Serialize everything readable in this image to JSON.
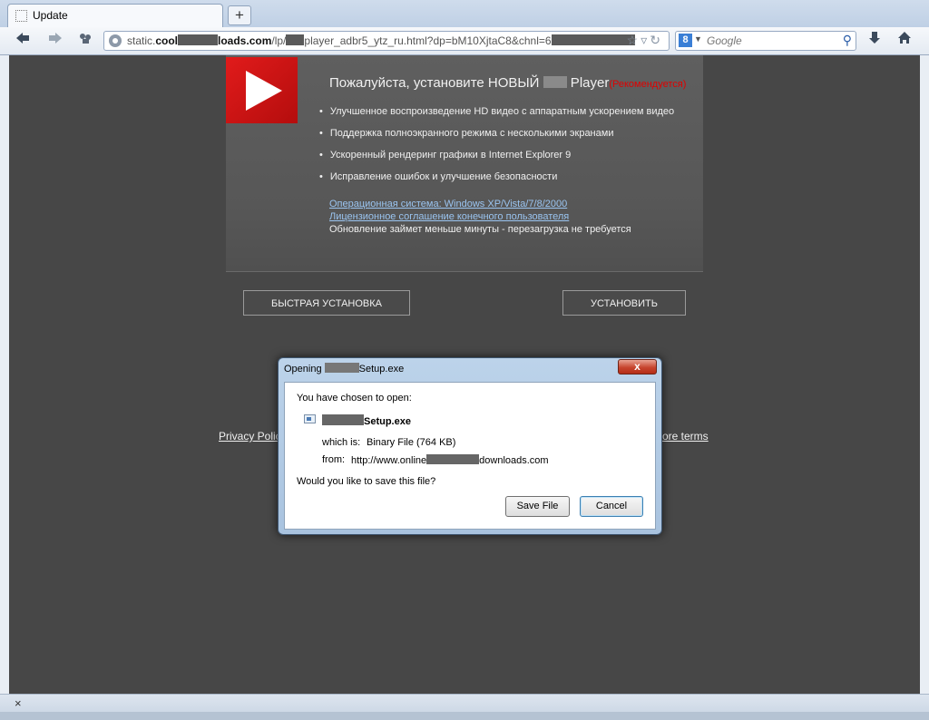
{
  "browser": {
    "tab_title": "Update",
    "new_tab_symbol": "+",
    "url_prefix": "static.",
    "url_host_start": "cool",
    "url_host_end": "loads.com",
    "url_path_start": "/lp/",
    "url_path_mid": "player_adbr5_ytz_ru.html?dp=bM10XjtaC8&chnl=6",
    "search_engine_badge": "8",
    "search_placeholder": "Google",
    "status_close_symbol": "×"
  },
  "page": {
    "headline_start": "Пожалуйста, установите НОВЫЙ",
    "headline_end": " Player",
    "headline_recommended": "(Рекомендуется)",
    "features": [
      "Улучшенное воспроизведение HD видео с аппаратным ускорением видео",
      "Поддержка полноэкранного режима с несколькими экранами",
      "Ускоренный рендеринг графики в Internet Explorer 9",
      "Исправление ошибок и улучшение безопасности"
    ],
    "link_os": "Операционная система: Windows XP/Vista/7/8/2000",
    "link_eula": "Лицензионное соглашение конечного пользователя",
    "update_note": "Обновление займет меньше минуты - перезагрузка не требуется",
    "quick_install_label": "БЫСТРАЯ УСТАНОВКА",
    "install_label": "УСТАНОВИТЬ",
    "footer_privacy": "Privacy Polic",
    "footer_terms": "ore terms"
  },
  "dialog": {
    "title_start": "Opening",
    "title_end": "Setup.exe",
    "close_symbol": "x",
    "intro": "You have chosen to open:",
    "file_name_end": "Setup.exe",
    "which_is_label": "which is:",
    "which_is_value": "Binary File (764 KB)",
    "from_label": "from:",
    "from_value_start": "http://www.online",
    "from_value_end": "downloads.com",
    "question": "Would you like to save this file?",
    "save_label": "Save File",
    "cancel_label": "Cancel"
  },
  "colors": {
    "page_bg": "#474747",
    "banner_bg": "#5a5a5a",
    "play_logo_red": "#d41414",
    "recommended_red": "#e00000",
    "link_blue": "#9ac4f0",
    "dialog_close_red": "#c7452f"
  },
  "icons": {
    "back": "back-arrow-icon",
    "forward": "forward-arrow-icon",
    "addons": "addons-icon",
    "site_identity": "site-identity-icon",
    "bookmark": "star-icon",
    "reload": "reload-icon",
    "search": "magnifier-icon",
    "downloads": "download-arrow-icon",
    "home": "home-icon"
  }
}
